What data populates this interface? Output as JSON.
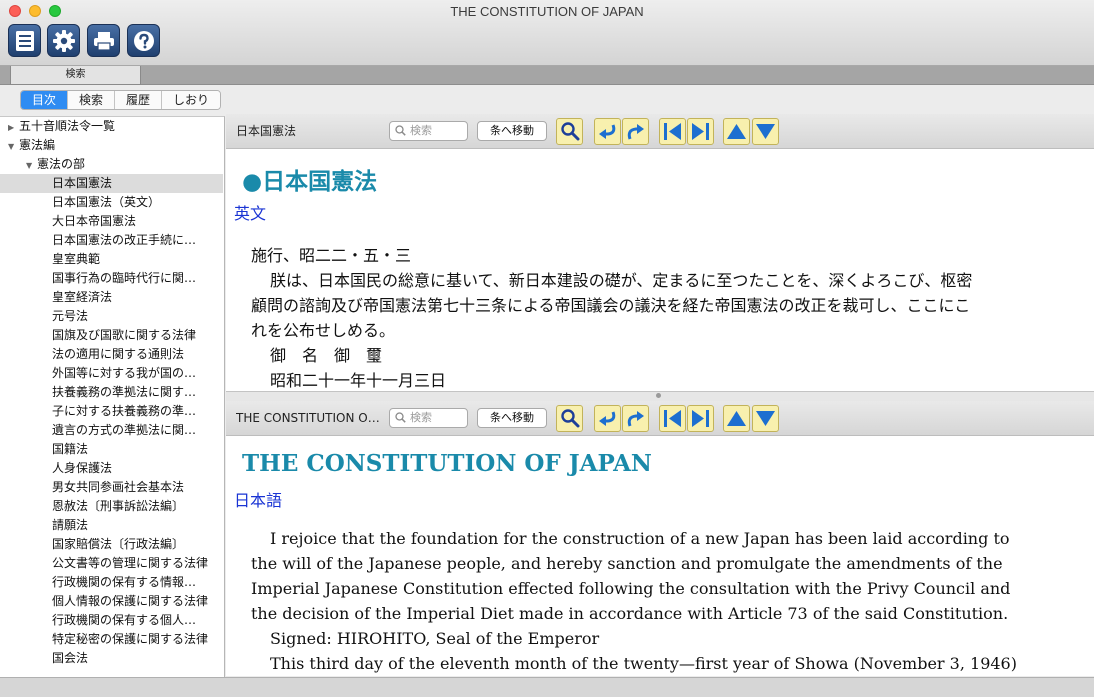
{
  "window": {
    "title": "THE CONSTITUTION OF JAPAN"
  },
  "toolbar": {
    "icons": [
      "list-icon",
      "gear-icon",
      "print-icon",
      "help-icon"
    ]
  },
  "search_tab": {
    "label": "検索"
  },
  "sidebar_tabs": [
    {
      "label": "目次",
      "active": true
    },
    {
      "label": "検索",
      "active": false
    },
    {
      "label": "履歴",
      "active": false
    },
    {
      "label": "しおり",
      "active": false
    }
  ],
  "tree": [
    {
      "label": "五十音順法令一覧",
      "level": 0,
      "toggle": "collapsed",
      "selected": false
    },
    {
      "label": "憲法編",
      "level": 0,
      "toggle": "expanded",
      "selected": false
    },
    {
      "label": "憲法の部",
      "level": 1,
      "toggle": "expanded",
      "selected": false
    },
    {
      "label": "日本国憲法",
      "level": 2,
      "toggle": "none",
      "selected": true
    },
    {
      "label": "日本国憲法（英文）",
      "level": 2,
      "toggle": "none",
      "selected": false
    },
    {
      "label": "大日本帝国憲法",
      "level": 2,
      "toggle": "none",
      "selected": false
    },
    {
      "label": "日本国憲法の改正手続に…",
      "level": 2,
      "toggle": "none",
      "selected": false
    },
    {
      "label": "皇室典範",
      "level": 2,
      "toggle": "none",
      "selected": false
    },
    {
      "label": "国事行為の臨時代行に関…",
      "level": 2,
      "toggle": "none",
      "selected": false
    },
    {
      "label": "皇室経済法",
      "level": 2,
      "toggle": "none",
      "selected": false
    },
    {
      "label": "元号法",
      "level": 2,
      "toggle": "none",
      "selected": false
    },
    {
      "label": "国旗及び国歌に関する法律",
      "level": 2,
      "toggle": "none",
      "selected": false
    },
    {
      "label": "法の適用に関する通則法",
      "level": 2,
      "toggle": "none",
      "selected": false
    },
    {
      "label": "外国等に対する我が国の…",
      "level": 2,
      "toggle": "none",
      "selected": false
    },
    {
      "label": "扶養義務の準拠法に関す…",
      "level": 2,
      "toggle": "none",
      "selected": false
    },
    {
      "label": "子に対する扶養義務の準…",
      "level": 2,
      "toggle": "none",
      "selected": false
    },
    {
      "label": "遺言の方式の準拠法に関…",
      "level": 2,
      "toggle": "none",
      "selected": false
    },
    {
      "label": "国籍法",
      "level": 2,
      "toggle": "none",
      "selected": false
    },
    {
      "label": "人身保護法",
      "level": 2,
      "toggle": "none",
      "selected": false
    },
    {
      "label": "男女共同参画社会基本法",
      "level": 2,
      "toggle": "none",
      "selected": false
    },
    {
      "label": "恩赦法〔刑事訴訟法編〕",
      "level": 2,
      "toggle": "none",
      "selected": false
    },
    {
      "label": "請願法",
      "level": 2,
      "toggle": "none",
      "selected": false
    },
    {
      "label": "国家賠償法〔行政法編〕",
      "level": 2,
      "toggle": "none",
      "selected": false
    },
    {
      "label": "公文書等の管理に関する法律",
      "level": 2,
      "toggle": "none",
      "selected": false
    },
    {
      "label": "行政機関の保有する情報…",
      "level": 2,
      "toggle": "none",
      "selected": false
    },
    {
      "label": "個人情報の保護に関する法律",
      "level": 2,
      "toggle": "none",
      "selected": false
    },
    {
      "label": "行政機関の保有する個人…",
      "level": 2,
      "toggle": "none",
      "selected": false
    },
    {
      "label": "特定秘密の保護に関する法律",
      "level": 2,
      "toggle": "none",
      "selected": false
    },
    {
      "label": "国会法",
      "level": 2,
      "toggle": "none",
      "selected": false
    }
  ],
  "pane_top": {
    "title": "日本国憲法",
    "search_placeholder": "検索",
    "goto_label": "条へ移動",
    "heading": "●日本国憲法",
    "link": "英文",
    "lines": [
      {
        "text": "施行、昭二二・五・三",
        "indent": false
      },
      {
        "text": "朕は、日本国民の総意に基いて、新日本建設の礎が、定まるに至つたことを、深くよろこび、枢密",
        "indent": true
      },
      {
        "text": "顧問の諮詢及び帝国憲法第七十三条による帝国議会の議決を経た帝国憲法の改正を裁可し、ここにこ",
        "indent": false
      },
      {
        "text": "れを公布せしめる。",
        "indent": false
      },
      {
        "text": "御　名　御　璽",
        "indent": true
      },
      {
        "text": "昭和二十一年十一月三日",
        "indent": true
      }
    ]
  },
  "pane_bottom": {
    "title": "THE CONSTITUTION OF JAPAN",
    "search_placeholder": "検索",
    "goto_label": "条へ移動",
    "heading": "THE CONSTITUTION OF JAPAN",
    "link": "日本語",
    "lines": [
      {
        "text": "I rejoice that the foundation for the construction of a new Japan has been laid according to",
        "indent": true
      },
      {
        "text": "the will of the Japanese people, and hereby sanction and promulgate the amendments of the",
        "indent": false
      },
      {
        "text": "Imperial Japanese Constitution effected following the consultation with the Privy Council and",
        "indent": false
      },
      {
        "text": "the decision of the Imperial Diet made in accordance with Article 73 of the said Constitution.",
        "indent": false
      },
      {
        "text": "Signed: HIROHITO, Seal of the Emperor",
        "indent": true
      },
      {
        "text": "This third day of the eleventh month of the twenty—first year of Showa (November 3, 1946)",
        "indent": true
      }
    ]
  },
  "nav_icons": [
    "search-icon",
    "back-icon",
    "forward-icon",
    "prev-icon",
    "next-icon",
    "up-icon",
    "down-icon"
  ]
}
